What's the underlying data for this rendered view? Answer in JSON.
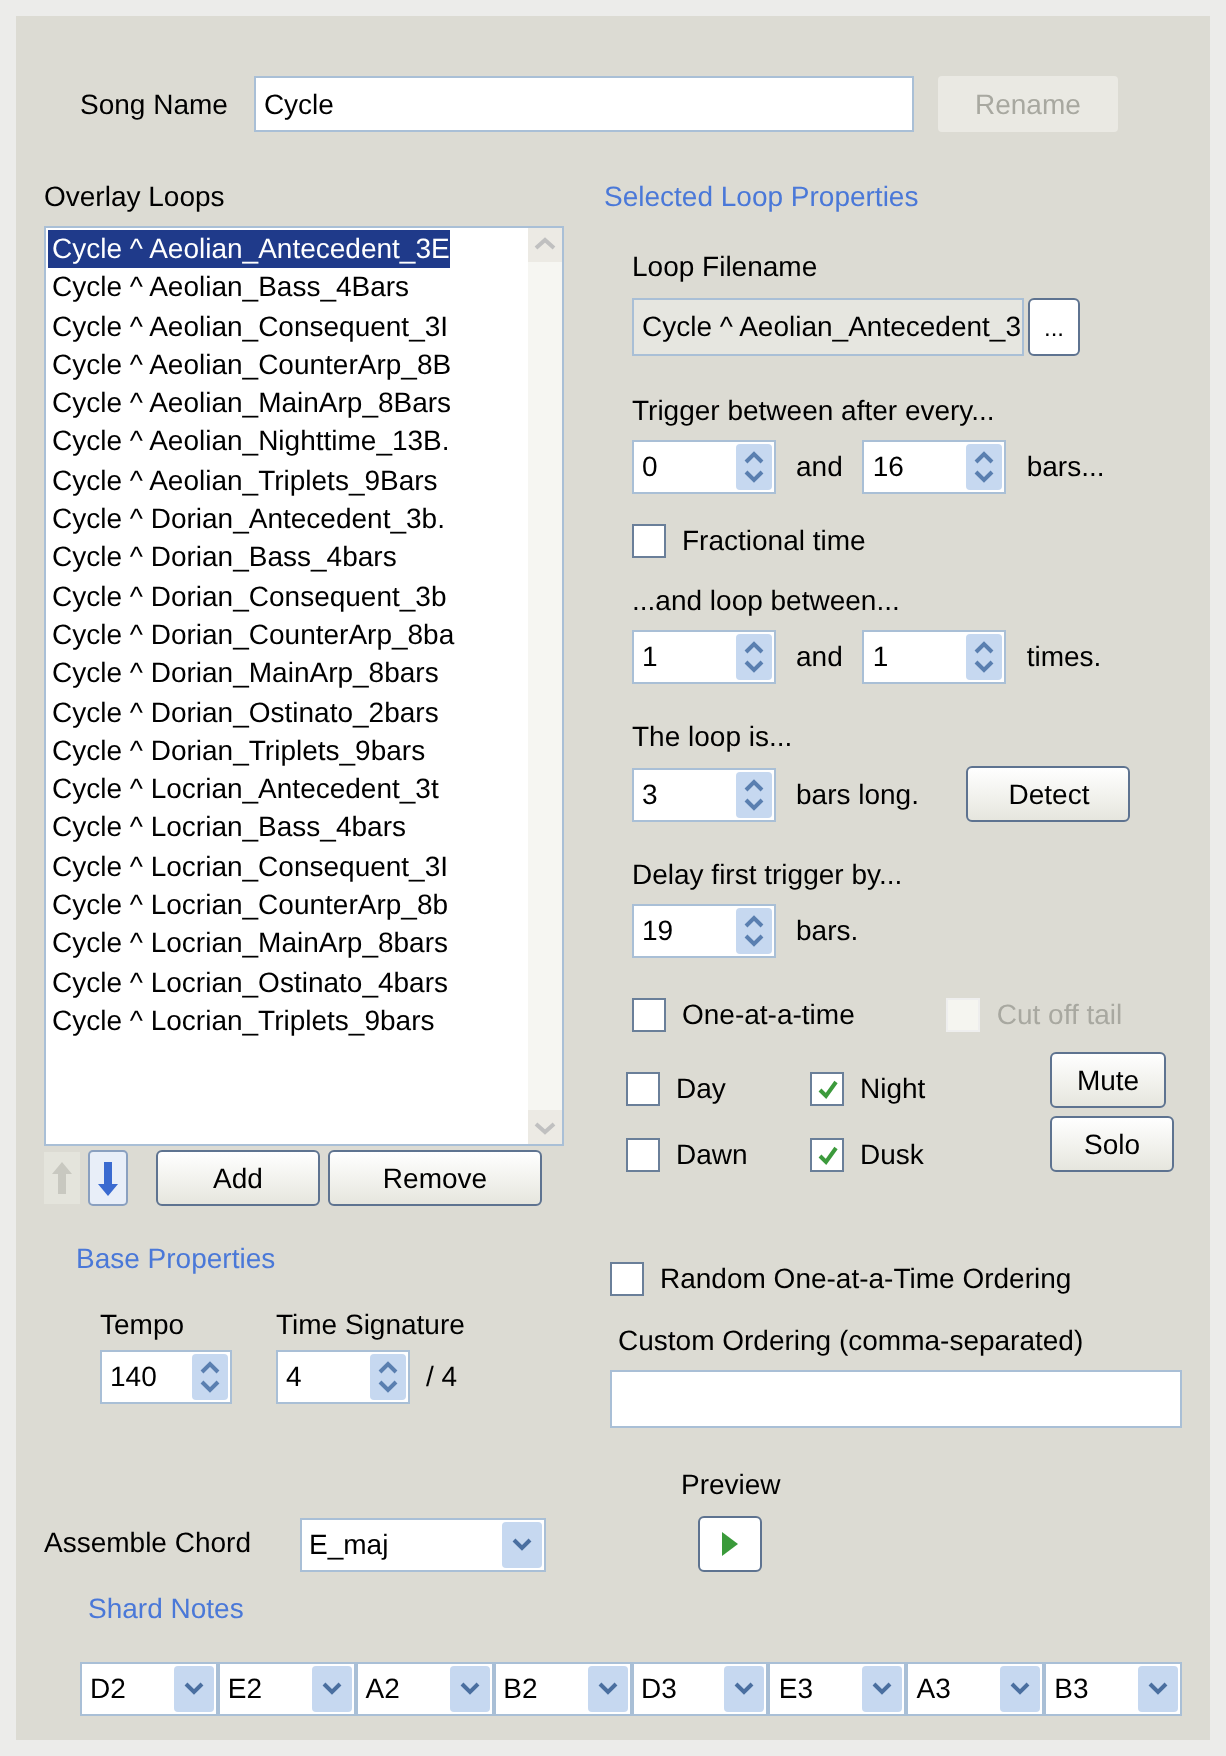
{
  "song_name": {
    "label": "Song Name",
    "value": "Cycle"
  },
  "rename_button": {
    "label": "Rename",
    "disabled": true
  },
  "overlay_loops": {
    "title": "Overlay Loops",
    "items": [
      {
        "label": "Cycle ^ Aeolian_Antecedent_3E",
        "selected": true
      },
      {
        "label": "Cycle ^ Aeolian_Bass_4Bars",
        "selected": false
      },
      {
        "label": "Cycle ^ Aeolian_Consequent_3I",
        "selected": false
      },
      {
        "label": "Cycle ^ Aeolian_CounterArp_8B",
        "selected": false
      },
      {
        "label": "Cycle ^ Aeolian_MainArp_8Bars",
        "selected": false
      },
      {
        "label": "Cycle ^ Aeolian_Nighttime_13B.",
        "selected": false
      },
      {
        "label": "Cycle ^ Aeolian_Triplets_9Bars",
        "selected": false
      },
      {
        "label": "Cycle ^ Dorian_Antecedent_3b.",
        "selected": false
      },
      {
        "label": "Cycle ^ Dorian_Bass_4bars",
        "selected": false
      },
      {
        "label": "Cycle ^ Dorian_Consequent_3b",
        "selected": false
      },
      {
        "label": "Cycle ^ Dorian_CounterArp_8ba",
        "selected": false
      },
      {
        "label": "Cycle ^ Dorian_MainArp_8bars",
        "selected": false
      },
      {
        "label": "Cycle ^ Dorian_Ostinato_2bars",
        "selected": false
      },
      {
        "label": "Cycle ^ Dorian_Triplets_9bars",
        "selected": false
      },
      {
        "label": "Cycle ^ Locrian_Antecedent_3t",
        "selected": false
      },
      {
        "label": "Cycle ^ Locrian_Bass_4bars",
        "selected": false
      },
      {
        "label": "Cycle ^ Locrian_Consequent_3I",
        "selected": false
      },
      {
        "label": "Cycle ^ Locrian_CounterArp_8b",
        "selected": false
      },
      {
        "label": "Cycle ^ Locrian_MainArp_8bars",
        "selected": false
      },
      {
        "label": "Cycle ^ Locrian_Ostinato_4bars",
        "selected": false
      },
      {
        "label": "Cycle ^ Locrian_Triplets_9bars",
        "selected": false
      }
    ]
  },
  "move_up_button": {
    "disabled": true
  },
  "move_down_button": {
    "disabled": false
  },
  "add_button": {
    "label": "Add"
  },
  "remove_button": {
    "label": "Remove"
  },
  "selected_loop": {
    "title": "Selected Loop Properties",
    "loop_filename": {
      "label": "Loop Filename",
      "value": "Cycle ^ Aeolian_Antecedent_3",
      "browse": "..."
    },
    "trigger": {
      "label": "Trigger between after every...",
      "min": "0",
      "and": "and",
      "max": "16",
      "unit": "bars..."
    },
    "fractional_time": {
      "label": "Fractional time",
      "checked": false
    },
    "loop_between": {
      "label": "...and loop between...",
      "min": "1",
      "and": "and",
      "max": "1",
      "unit": "times."
    },
    "loop_length": {
      "label": "The loop is...",
      "value": "3",
      "unit": "bars long.",
      "detect": "Detect"
    },
    "delay": {
      "label": "Delay first trigger by...",
      "value": "19",
      "unit": "bars."
    },
    "one_at_a_time": {
      "label": "One-at-a-time",
      "checked": false
    },
    "cut_off_tail": {
      "label": "Cut off tail",
      "checked": false,
      "disabled": true
    },
    "times_of_day": [
      {
        "label": "Day",
        "checked": false
      },
      {
        "label": "Night",
        "checked": true
      },
      {
        "label": "Dawn",
        "checked": false
      },
      {
        "label": "Dusk",
        "checked": true
      }
    ],
    "mute_button": "Mute",
    "solo_button": "Solo"
  },
  "base_properties": {
    "title": "Base Properties",
    "tempo": {
      "label": "Tempo",
      "value": "140"
    },
    "time_signature": {
      "label": "Time Signature",
      "value": "4",
      "denominator": "/ 4"
    }
  },
  "random_ordering": {
    "label": "Random One-at-a-Time Ordering",
    "checked": false
  },
  "custom_ordering": {
    "label": "Custom Ordering (comma-separated)"
  },
  "preview": {
    "label": "Preview"
  },
  "assemble_chord": {
    "label": "Assemble Chord",
    "value": "E_maj"
  },
  "shard_notes": {
    "title": "Shard Notes",
    "notes": [
      "D2",
      "E2",
      "A2",
      "B2",
      "D3",
      "E3",
      "A3",
      "B3"
    ]
  }
}
